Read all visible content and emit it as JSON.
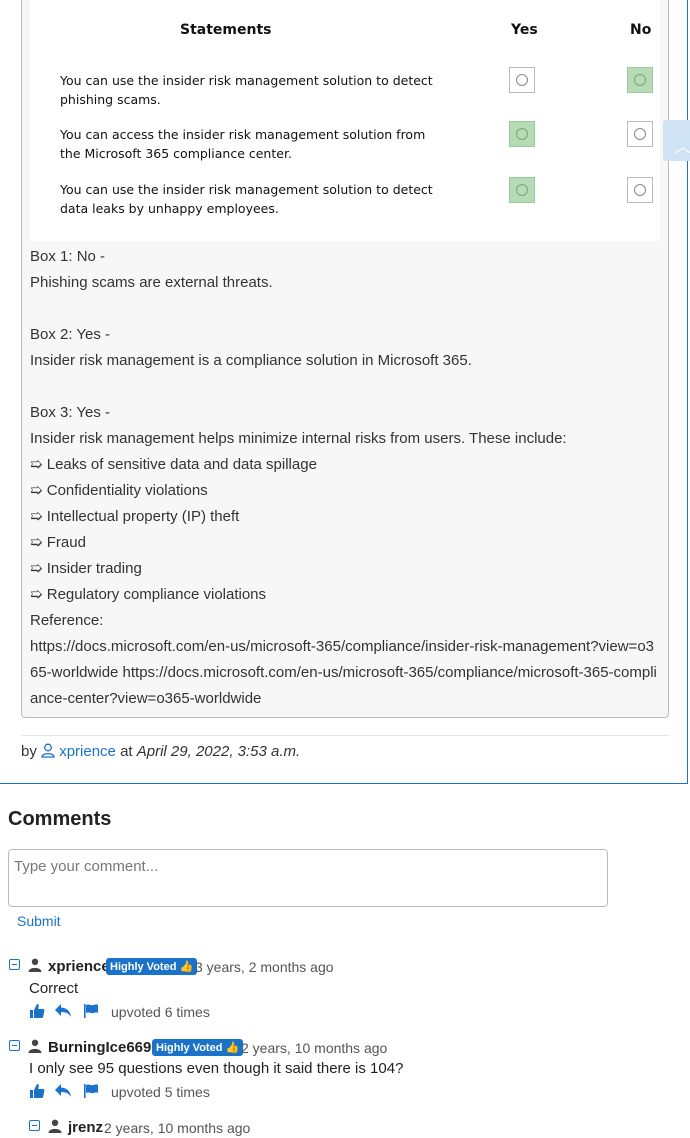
{
  "question": {
    "headers": {
      "statements": "Statements",
      "yes": "Yes",
      "no": "No"
    },
    "rows": [
      {
        "line1": "You can use the insider risk management solution to detect",
        "line2": "phishing scams.",
        "answer": "No"
      },
      {
        "line1": "You can access the insider risk management solution from",
        "line2": "the Microsoft 365 compliance center.",
        "answer": "Yes"
      },
      {
        "line1": "You can use the insider risk management solution to detect",
        "line2": "data leaks by unhappy employees.",
        "answer": "Yes"
      }
    ]
  },
  "explanation": {
    "box1_title": "Box 1: No -",
    "box1_text": "Phishing scams are external threats.",
    "box2_title": "Box 2: Yes -",
    "box2_text": "Insider risk management is a compliance solution in Microsoft 365.",
    "box3_title": "Box 3: Yes -",
    "box3_text": "Insider risk management helps minimize internal risks from users. These include:",
    "bullets": [
      "➯ Leaks of sensitive data and data spillage",
      "➯ Confidentiality violations",
      "➯ Intellectual property (IP) theft",
      "➯ Fraud",
      "➯ Insider trading",
      "➯ Regulatory compliance violations"
    ],
    "reference_label": "Reference:",
    "reference_urls": "https://docs.microsoft.com/en-us/microsoft-365/compliance/insider-risk-management?view=o365-worldwide https://docs.microsoft.com/en-us/microsoft-365/compliance/microsoft-365-compliance-center?view=o365-worldwide"
  },
  "byline": {
    "by": "by",
    "user": "xprience",
    "at": "at",
    "date": "April 29, 2022, 3:53 a.m."
  },
  "comments_section": {
    "heading": "Comments",
    "placeholder": "Type your comment...",
    "submit_label": "Submit"
  },
  "comments": [
    {
      "user": "xprience",
      "badge": "Highly Voted",
      "ago": "3 years, 2 months ago",
      "text": "Correct",
      "upvotes": "upvoted 6 times"
    },
    {
      "user": "BurningIce6699",
      "badge": "Highly Voted",
      "ago": "2 years, 10 months ago",
      "text": "I only see 95 questions even though it said there is 104?",
      "upvotes": "upvoted 5 times"
    },
    {
      "user": "jrenz",
      "ago": "2 years, 10 months ago"
    }
  ],
  "colors": {
    "accent": "#1a73c8",
    "selected_green": "#b6dcb6"
  }
}
